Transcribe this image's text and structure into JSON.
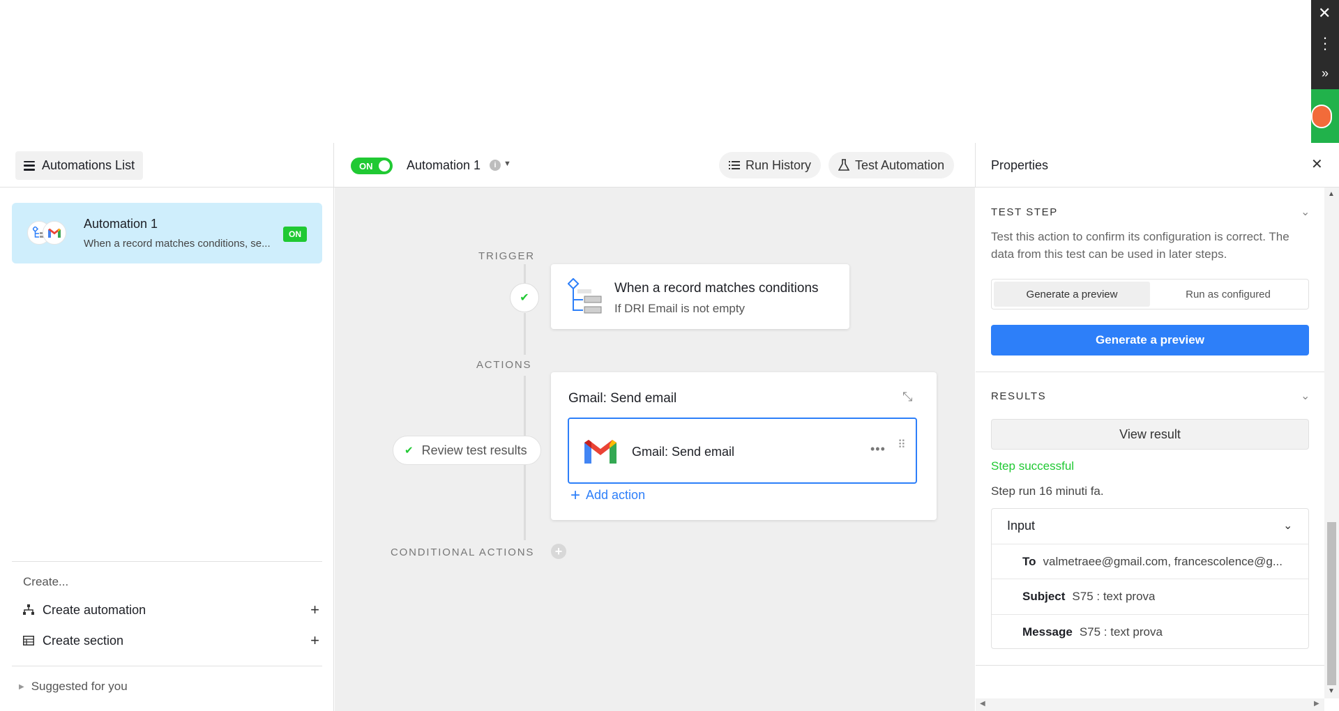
{
  "sidebar_header": {
    "automations_list_label": "Automations List"
  },
  "toolbar": {
    "toggle_label": "ON",
    "automation_title": "Automation 1",
    "run_history_label": "Run History",
    "test_automation_label": "Test Automation"
  },
  "properties_header": {
    "title": "Properties"
  },
  "sidebar": {
    "automation_card": {
      "title": "Automation 1",
      "subtitle": "When a record matches conditions, se...",
      "badge": "ON"
    },
    "create_heading": "Create...",
    "create_automation_label": "Create automation",
    "create_section_label": "Create section",
    "suggested_label": "Suggested for you"
  },
  "canvas": {
    "trigger_label": "TRIGGER",
    "actions_label": "ACTIONS",
    "conditional_actions_label": "CONDITIONAL ACTIONS",
    "trigger_card": {
      "title": "When a record matches conditions",
      "subtitle": "If DRI Email is not empty"
    },
    "action_card": {
      "title": "Gmail: Send email",
      "step_label": "Gmail: Send email",
      "add_action_label": "Add action"
    },
    "review_pill_label": "Review test results"
  },
  "properties": {
    "test_step_heading": "TEST STEP",
    "test_step_description": "Test this action to confirm its configuration is correct. The data from this test can be used in later steps.",
    "segmented": [
      "Generate a preview",
      "Run as configured"
    ],
    "generate_button_label": "Generate a preview",
    "results_heading": "RESULTS",
    "view_result_label": "View result",
    "step_success": "Step successful",
    "step_run": "Step run 16 minuti fa.",
    "input": {
      "heading": "Input",
      "rows": [
        {
          "key": "To",
          "value": "valmetraee@gmail.com, francescolence@g..."
        },
        {
          "key": "Subject",
          "value": "S75 : text prova"
        },
        {
          "key": "Message",
          "value": "S75 : text prova"
        }
      ]
    }
  },
  "colors": {
    "accent_blue": "#2d7ff9",
    "success_green": "#20c933",
    "selected_card": "#cfeefc",
    "canvas_bg": "#efefef"
  },
  "icons": [
    "close-icon",
    "menu-icon",
    "info-icon",
    "caret-down-icon",
    "run-history-icon",
    "flask-icon",
    "trigger-icon",
    "gmail-icon",
    "check-icon",
    "collapse-icon",
    "more-icon",
    "drag-handle-icon",
    "plus-icon",
    "chevron-down-icon"
  ]
}
